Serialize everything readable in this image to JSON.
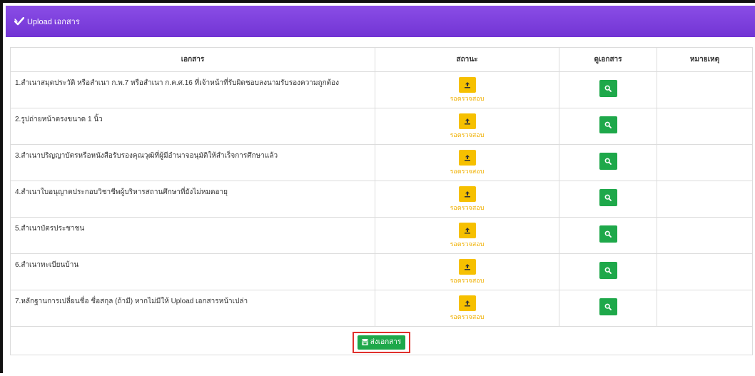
{
  "panel": {
    "title": "Upload เอกสาร",
    "header_color": "#7e3fdc"
  },
  "table": {
    "headers": [
      "เอกสาร",
      "สถานะ",
      "ดูเอกสาร",
      "หมายเหตุ"
    ],
    "rows": [
      {
        "document": "1.สำเนาสมุดประวัติ หรือสำเนา ก.พ.7 หรือสำเนา ก.ค.ศ.16 ที่เจ้าหน้าที่รับผิดชอบลงนามรับรองความถูกต้อง",
        "status": "รอตรวจสอบ",
        "note": ""
      },
      {
        "document": "2.รูปถ่ายหน้าตรงขนาด 1 นิ้ว",
        "status": "รอตรวจสอบ",
        "note": ""
      },
      {
        "document": "3.สำเนาปริญญาบัตรหรือหนังสือรับรองคุณวุฒิที่ผู้มีอำนาจอนุมัติให้สำเร็จการศึกษาแล้ว",
        "status": "รอตรวจสอบ",
        "note": ""
      },
      {
        "document": "4.สำเนาใบอนุญาตประกอบวิชาชีพผู้บริหารสถานศึกษาที่ยังไม่หมดอายุ",
        "status": "รอตรวจสอบ",
        "note": ""
      },
      {
        "document": "5.สำเนาบัตรประชาชน",
        "status": "รอตรวจสอบ",
        "note": ""
      },
      {
        "document": "6.สำเนาทะเบียนบ้าน",
        "status": "รอตรวจสอบ",
        "note": ""
      },
      {
        "document": "7.หลักฐานการเปลี่ยนชื่อ ชื่อสกุล (ถ้ามี) หากไม่มีให้ Upload เอกสารหน้าเปล่า",
        "status": "รอตรวจสอบ",
        "note": ""
      }
    ]
  },
  "submit": {
    "label": "ส่งเอกสาร",
    "color": "#1ea84a",
    "highlight_color": "#e0302c"
  },
  "icons": {
    "header": "check-icon",
    "upload": "upload-icon",
    "view": "search-icon",
    "submit": "save-icon"
  },
  "colors": {
    "upload_button": "#f6c000",
    "status_text": "#f0b000",
    "view_button": "#1ea84a"
  }
}
